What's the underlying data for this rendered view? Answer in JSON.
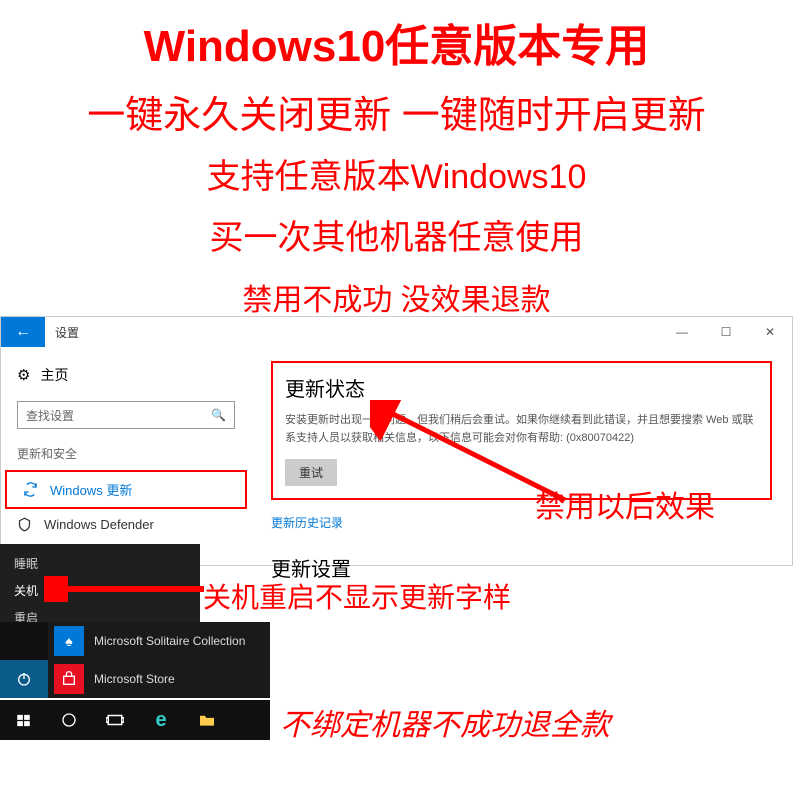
{
  "promo": {
    "title": "Windows10任意版本专用",
    "line2": "一键永久关闭更新 一键随时开启更新",
    "line3": "支持任意版本Windows10",
    "line4": "买一次其他机器任意使用",
    "line5": "禁用不成功  没效果退款"
  },
  "settings": {
    "window_title": "设置",
    "home": "主页",
    "search_placeholder": "查找设置",
    "section": "更新和安全",
    "nav": {
      "windows_update": "Windows 更新",
      "defender": "Windows Defender"
    },
    "status": {
      "title": "更新状态",
      "desc": "安装更新时出现一些问题，但我们稍后会重试。如果你继续看到此错误，并且想要搜索 Web 或联系支持人员以获取相关信息，以下信息可能会对你有帮助: (0x80070422)",
      "retry": "重试",
      "history": "更新历史记录"
    },
    "update_settings_title": "更新设置"
  },
  "annotations": {
    "disable_effect": "禁用以后效果",
    "shutdown_note": "关机重启不显示更新字样",
    "refund": "不绑定机器不成功退全款"
  },
  "power_menu": {
    "sleep": "睡眠",
    "shutdown": "关机",
    "restart": "重启"
  },
  "start": {
    "solitaire": "Microsoft Solitaire Collection",
    "store": "Microsoft Store"
  }
}
